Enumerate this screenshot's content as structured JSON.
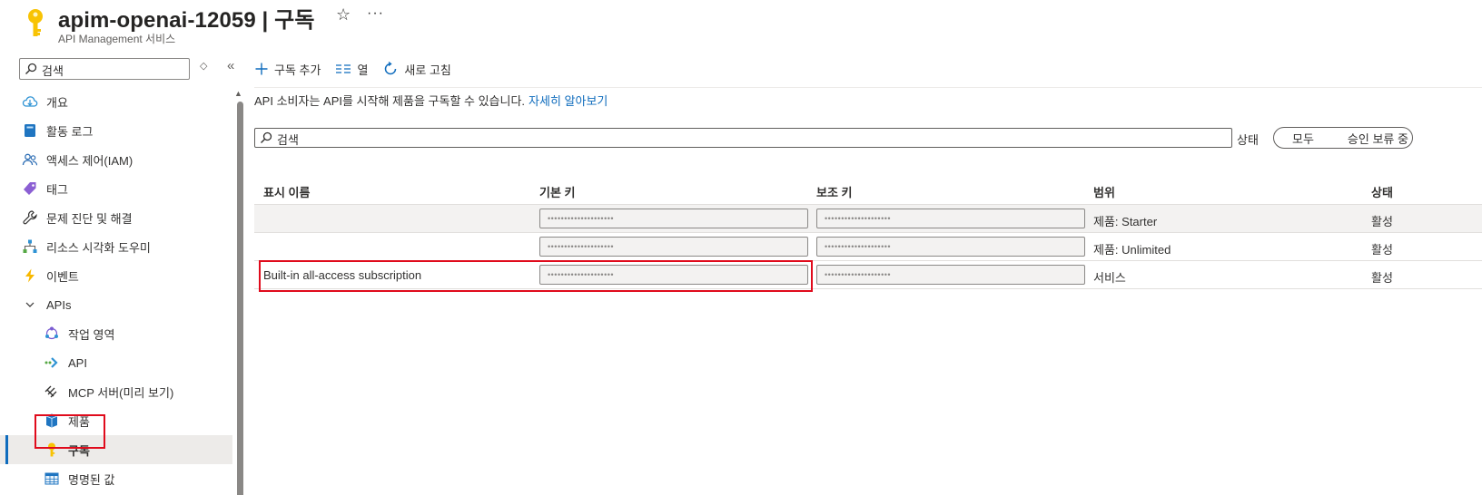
{
  "header": {
    "title": "apim-openai-12059 | 구독",
    "subtitle": "API Management 서비스",
    "star_glyph": "☆",
    "more_glyph": "···",
    "key_icon_color": "#f8c304"
  },
  "sidebar": {
    "search_placeholder": "검색",
    "updown_glyph": "◇",
    "collapse_glyph": "«",
    "items": [
      {
        "label": "개요",
        "icon": "cloud-icon"
      },
      {
        "label": "활동 로그",
        "icon": "book-icon"
      },
      {
        "label": "액세스 제어(IAM)",
        "icon": "people-icon"
      },
      {
        "label": "태그",
        "icon": "tag-icon"
      },
      {
        "label": "문제 진단 및 해결",
        "icon": "wrench-icon"
      },
      {
        "label": "리소스 시각화 도우미",
        "icon": "hierarchy-icon"
      },
      {
        "label": "이벤트",
        "icon": "lightning-icon"
      },
      {
        "label": "APIs",
        "icon": "chevron-down-icon"
      },
      {
        "label": "작업 영역",
        "icon": "workspace-icon"
      },
      {
        "label": "API",
        "icon": "api-arrow-icon"
      },
      {
        "label": "MCP 서버(미리 보기)",
        "icon": "mcp-icon"
      },
      {
        "label": "제품",
        "icon": "cube-icon"
      },
      {
        "label": "구독",
        "icon": "key-icon"
      },
      {
        "label": "명명된 값",
        "icon": "table-icon"
      }
    ]
  },
  "toolbar": {
    "add_label": "구독 추가",
    "columns_label": "열",
    "refresh_label": "새로 고침"
  },
  "info": {
    "text": "API 소비자는 API를 시작해 제품을 구독할 수 있습니다.",
    "link": "자세히 알아보기"
  },
  "filter": {
    "search_placeholder": "검색",
    "status_label": "상태",
    "status_options": [
      "모두",
      "승인 보류 중"
    ]
  },
  "table": {
    "headers": [
      "표시 이름",
      "기본 키",
      "보조 키",
      "범위",
      "상태"
    ],
    "masked_key": "••••••••••••••••••••",
    "rows": [
      {
        "name": "",
        "scope": "제품: Starter",
        "status": "활성"
      },
      {
        "name": "",
        "scope": "제품: Unlimited",
        "status": "활성"
      },
      {
        "name": "Built-in all-access subscription",
        "scope": "서비스",
        "status": "활성"
      }
    ]
  },
  "colors": {
    "accent": "#0f6cbd",
    "highlight_box": "#e00b1c",
    "active_nav_bg": "#edebe9"
  }
}
